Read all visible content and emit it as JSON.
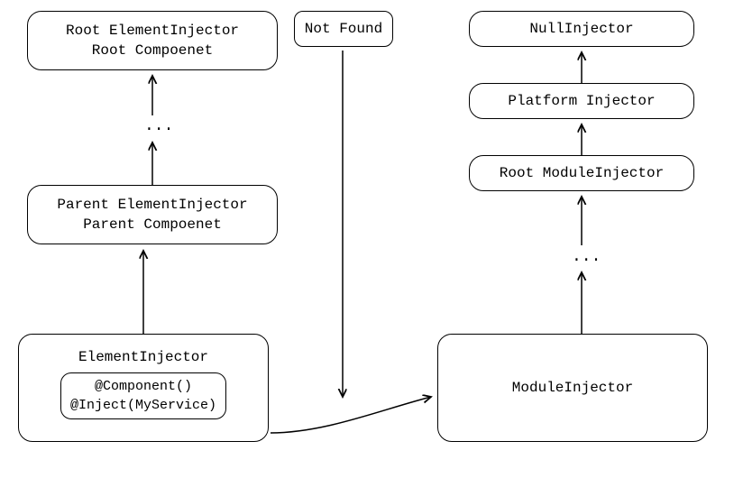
{
  "left": {
    "root": {
      "line1": "Root ElementInjector",
      "line2": "Root Compoenet"
    },
    "parent": {
      "line1": "Parent ElementInjector",
      "line2": "Parent Compoenet"
    },
    "element": {
      "title": "ElementInjector",
      "inner_line1": "@Component()",
      "inner_line2": "@Inject(MyService)"
    },
    "ellipsis": "..."
  },
  "right": {
    "null_injector": "NullInjector",
    "platform_injector": "Platform Injector",
    "root_module_injector": "Root ModuleInjector",
    "module_injector": "ModuleInjector",
    "ellipsis": "..."
  },
  "not_found": "Not Found"
}
